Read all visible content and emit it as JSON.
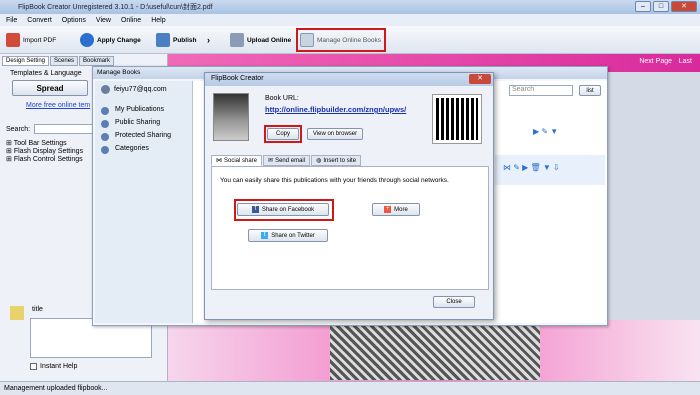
{
  "app": {
    "title": "FlipBook Creator Unregistered 3.10.1 - D:\\useful\\cun\\封面2.pdf"
  },
  "menu": [
    "File",
    "Convert",
    "Options",
    "View",
    "Online",
    "Help"
  ],
  "toolbar": {
    "import": "Import PDF",
    "apply": "Apply Change",
    "publish": "Publish",
    "upload": "Upload Online",
    "manage": "Manage Online Books"
  },
  "left": {
    "tabs": [
      "Design Setting",
      "Scenes",
      "Bookmark"
    ],
    "templates_label": "Templates & Language",
    "spread_label": "Spread",
    "more_templates": "More free online tem",
    "search_label": "Search:",
    "settings": [
      "Tool Bar Settings",
      "Flash Display Settings",
      "Flash Control Settings"
    ],
    "title_label": "title",
    "instant_help": "Instant Help"
  },
  "viewer": {
    "next_page": "Next Page",
    "last": "Last"
  },
  "status": "Management uploaded flipbook...",
  "manage": {
    "title": "Manage Books",
    "user": "feiyu77@qq.com",
    "nav": [
      "My Publications",
      "Public Sharing",
      "Protected Sharing",
      "Categories"
    ],
    "search_placeholder": "Search",
    "list_button": "list"
  },
  "dialog": {
    "title": "FlipBook Creator",
    "book_url_label": "Book URL:",
    "book_url": "http://online.flipbuilder.com/zngn/upws/",
    "copy": "Copy",
    "view_browser": "View on browser",
    "tabs": [
      "Social share",
      "Send email",
      "Insert to site"
    ],
    "share_text": "You can easily share this publications with your friends through social networks.",
    "facebook": "Share on Facebook",
    "more": "More",
    "twitter": "Share on Twitter",
    "close": "Close"
  }
}
